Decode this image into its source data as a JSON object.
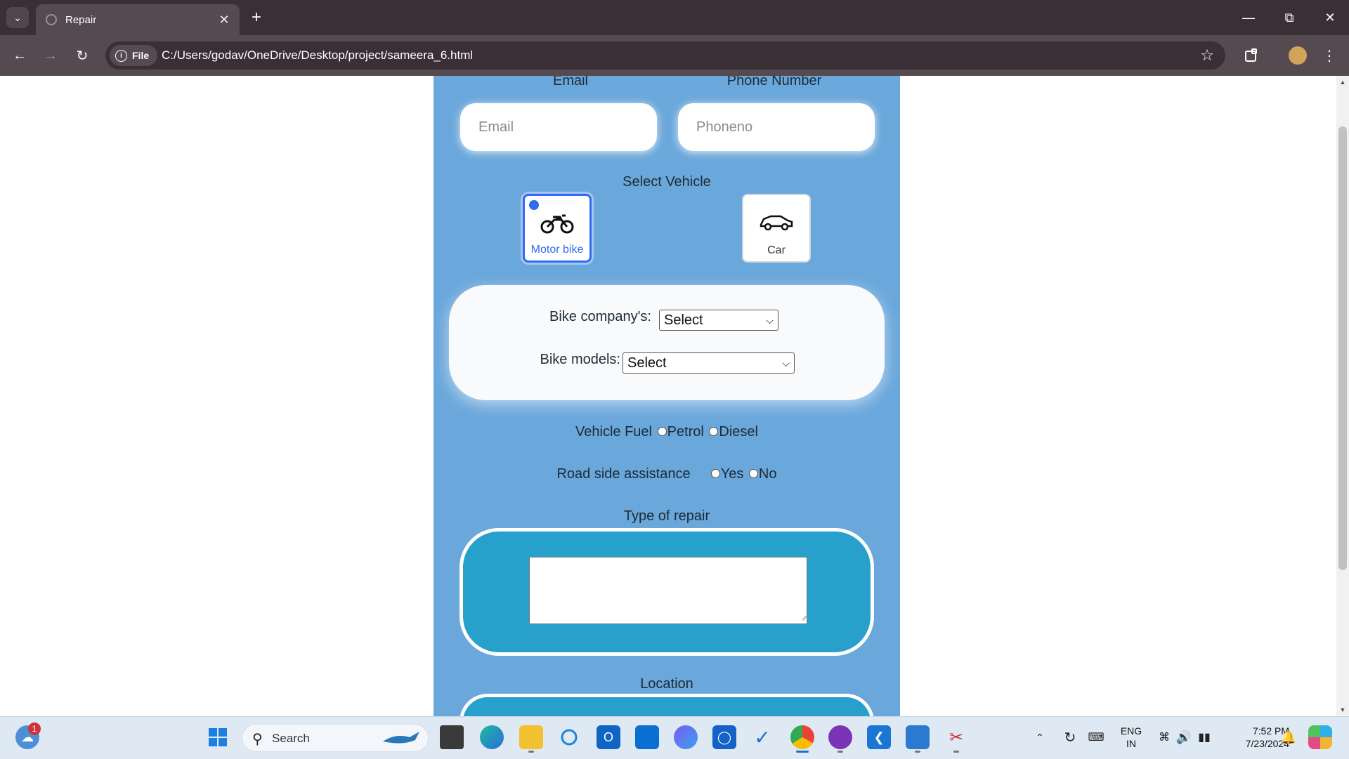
{
  "browser": {
    "tab_title": "Repair",
    "new_tab": "+",
    "chip_label": "File",
    "url": "C:/Users/godav/OneDrive/Desktop/project/sameera_6.html"
  },
  "form": {
    "email_label": "Email",
    "email_placeholder": "Email",
    "phone_label": "Phone Number",
    "phone_placeholder": "Phoneno",
    "select_vehicle_label": "Select Vehicle",
    "vehicles": [
      {
        "label": "Motor bike",
        "selected": true
      },
      {
        "label": "Car",
        "selected": false
      }
    ],
    "bike_company_label": "Bike company's:",
    "bike_company_value": "Select",
    "bike_models_label": "Bike models:",
    "bike_models_value": "Select",
    "fuel_label": "Vehicle Fuel",
    "fuel_options": [
      "Petrol",
      "Diesel"
    ],
    "roadside_label": "Road side assistance",
    "roadside_options": [
      "Yes",
      "No"
    ],
    "repair_label": "Type of repair",
    "location_label": "Location"
  },
  "taskbar": {
    "weather_badge": "1",
    "search_label": "Search",
    "lang_top": "ENG",
    "lang_bottom": "IN",
    "time": "7:52 PM",
    "date": "7/23/2024"
  },
  "colors": {
    "panel": "#6aa7db",
    "repair_box": "#27a0cc",
    "selected_accent": "#2f6cf0"
  }
}
